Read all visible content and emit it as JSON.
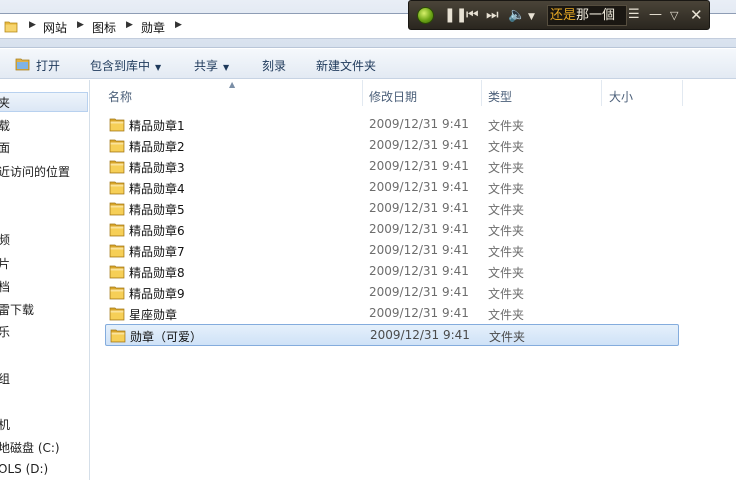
{
  "address": {
    "breadcrumbs": [
      "网站",
      "图标",
      "勋章"
    ]
  },
  "player": {
    "lyric_part1": "还是",
    "lyric_part2": "那一個"
  },
  "toolbar": {
    "open": "打开",
    "include_in_library": "包含到库中",
    "share": "共享",
    "burn": "刻录",
    "new_folder": "新建文件夹"
  },
  "nav": {
    "items": [
      "夹",
      "载",
      "面",
      "近访问的位置",
      "频",
      "片",
      "档",
      "雷下载",
      "乐",
      "组",
      "机",
      "地磁盘 (C:)",
      "OLS (D:)"
    ]
  },
  "columns": {
    "name": "名称",
    "modified": "修改日期",
    "type": "类型",
    "size": "大小"
  },
  "files": [
    {
      "name": "精品勋章1",
      "date": "2009/12/31 9:41",
      "type": "文件夹"
    },
    {
      "name": "精品勋章2",
      "date": "2009/12/31 9:41",
      "type": "文件夹"
    },
    {
      "name": "精品勋章3",
      "date": "2009/12/31 9:41",
      "type": "文件夹"
    },
    {
      "name": "精品勋章4",
      "date": "2009/12/31 9:41",
      "type": "文件夹"
    },
    {
      "name": "精品勋章5",
      "date": "2009/12/31 9:41",
      "type": "文件夹"
    },
    {
      "name": "精品勋章6",
      "date": "2009/12/31 9:41",
      "type": "文件夹"
    },
    {
      "name": "精品勋章7",
      "date": "2009/12/31 9:41",
      "type": "文件夹"
    },
    {
      "name": "精品勋章8",
      "date": "2009/12/31 9:41",
      "type": "文件夹"
    },
    {
      "name": "精品勋章9",
      "date": "2009/12/31 9:41",
      "type": "文件夹"
    },
    {
      "name": "星座勋章",
      "date": "2009/12/31 9:41",
      "type": "文件夹"
    },
    {
      "name": "勋章（可爱）",
      "date": "2009/12/31 9:41",
      "type": "文件夹",
      "selected": true
    }
  ]
}
